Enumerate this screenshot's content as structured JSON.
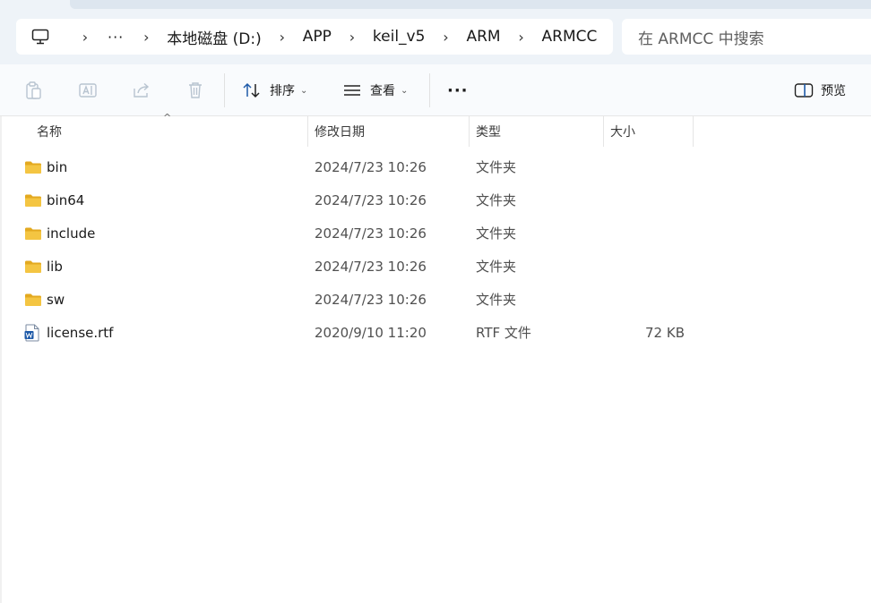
{
  "address": {
    "crumbs": [
      "本地磁盘 (D:)",
      "APP",
      "keil_v5",
      "ARM",
      "ARMCC"
    ],
    "overflow": "···"
  },
  "search": {
    "placeholder": "在 ARMCC 中搜索"
  },
  "toolbar": {
    "sort_label": "排序",
    "view_label": "查看",
    "more_label": "···",
    "preview_label": "预览"
  },
  "columns": {
    "name": "名称",
    "date": "修改日期",
    "type": "类型",
    "size": "大小"
  },
  "files": [
    {
      "name": "bin",
      "date": "2024/7/23 10:26",
      "type": "文件夹",
      "size": "",
      "icon": "folder-icon"
    },
    {
      "name": "bin64",
      "date": "2024/7/23 10:26",
      "type": "文件夹",
      "size": "",
      "icon": "folder-icon"
    },
    {
      "name": "include",
      "date": "2024/7/23 10:26",
      "type": "文件夹",
      "size": "",
      "icon": "folder-icon"
    },
    {
      "name": "lib",
      "date": "2024/7/23 10:26",
      "type": "文件夹",
      "size": "",
      "icon": "folder-icon"
    },
    {
      "name": "sw",
      "date": "2024/7/23 10:26",
      "type": "文件夹",
      "size": "",
      "icon": "folder-icon"
    },
    {
      "name": "license.rtf",
      "date": "2020/9/10 11:20",
      "type": "RTF 文件",
      "size": "72 KB",
      "icon": "word-document-icon"
    }
  ],
  "colors": {
    "folder": "#f4c542",
    "folder_dark": "#e3a920",
    "accent": "#1e5aa8"
  }
}
